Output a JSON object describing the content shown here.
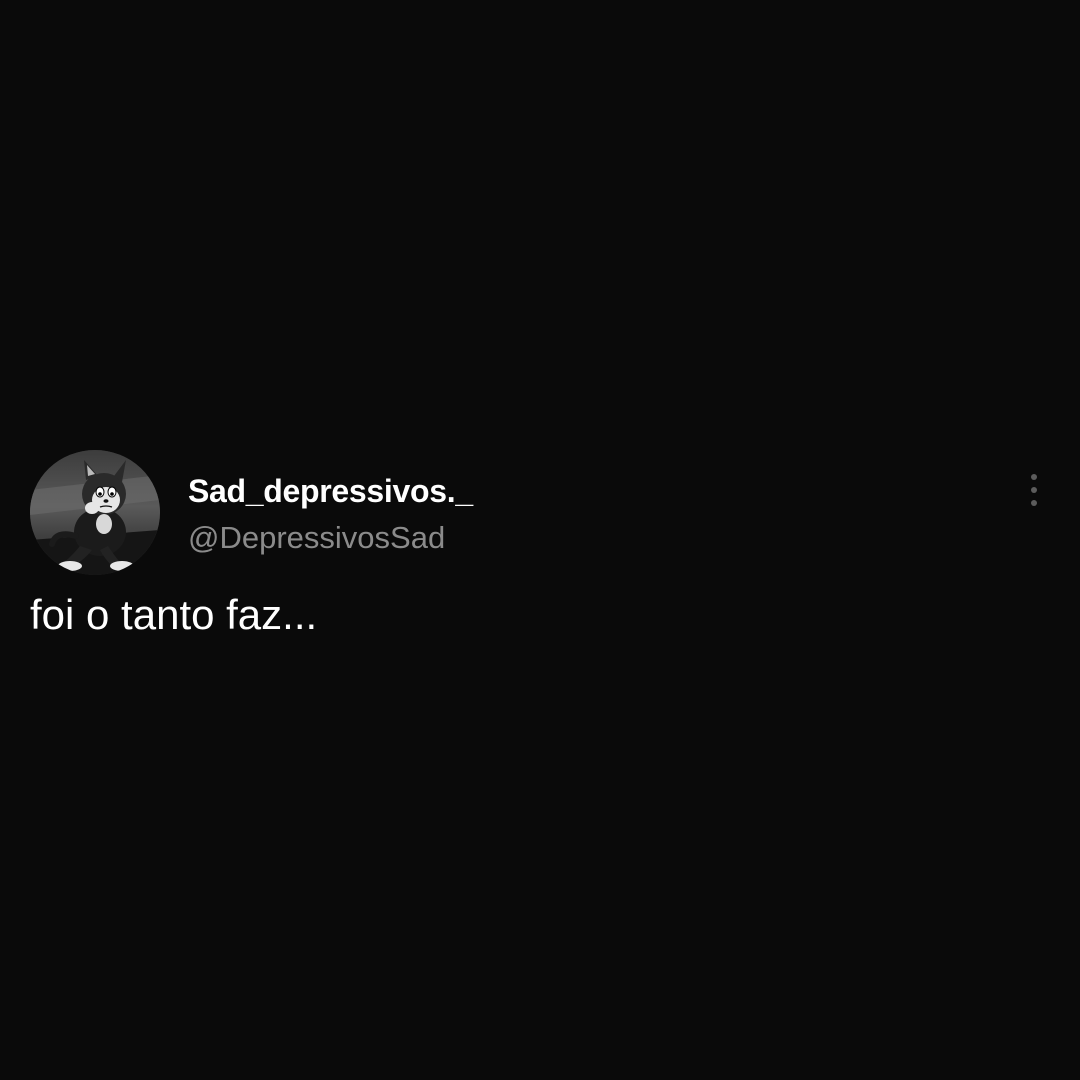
{
  "tweet": {
    "display_name": "Sad_depressivos._",
    "handle": "@DepressivosSad",
    "text": "foi o tanto faz...",
    "avatar_icon": "sad-cartoon-cat-avatar",
    "more_icon": "vertical-ellipsis-icon"
  },
  "colors": {
    "background": "#0a0a0a",
    "text_primary": "#ffffff",
    "text_secondary": "#8b8b8b"
  }
}
